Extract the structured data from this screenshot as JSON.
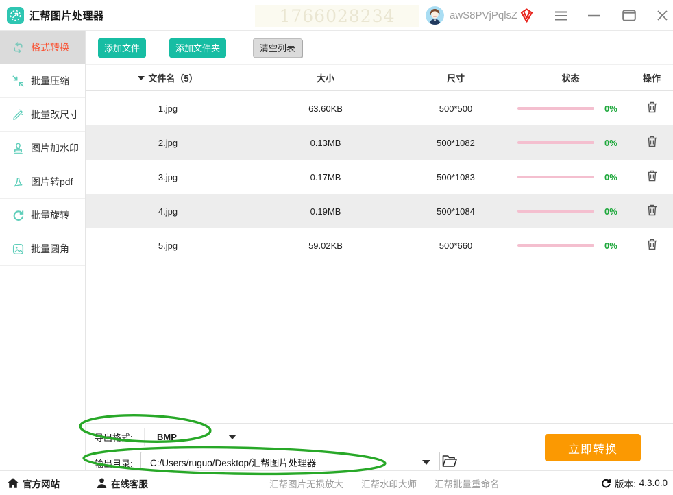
{
  "window": {
    "title": "汇帮图片处理器",
    "watermark_text": "1766028234",
    "user": {
      "name": "awS8PVjPqlsZ"
    }
  },
  "sidebar": {
    "items": [
      {
        "label": "格式转换",
        "active": true
      },
      {
        "label": "批量压缩",
        "active": false
      },
      {
        "label": "批量改尺寸",
        "active": false
      },
      {
        "label": "图片加水印",
        "active": false
      },
      {
        "label": "图片转pdf",
        "active": false
      },
      {
        "label": "批量旋转",
        "active": false
      },
      {
        "label": "批量圆角",
        "active": false
      }
    ]
  },
  "toolbar": {
    "add_file": "添加文件",
    "add_folder": "添加文件夹",
    "clear_list": "清空列表"
  },
  "table": {
    "headers": {
      "name": "文件名（5）",
      "size": "大小",
      "dimensions": "尺寸",
      "status": "状态",
      "action": "操作"
    },
    "rows": [
      {
        "name": "1.jpg",
        "size": "63.60KB",
        "dimensions": "500*500",
        "progress_label": "0%"
      },
      {
        "name": "2.jpg",
        "size": "0.13MB",
        "dimensions": "500*1082",
        "progress_label": "0%"
      },
      {
        "name": "3.jpg",
        "size": "0.17MB",
        "dimensions": "500*1083",
        "progress_label": "0%"
      },
      {
        "name": "4.jpg",
        "size": "0.19MB",
        "dimensions": "500*1084",
        "progress_label": "0%"
      },
      {
        "name": "5.jpg",
        "size": "59.02KB",
        "dimensions": "500*660",
        "progress_label": "0%"
      }
    ]
  },
  "output": {
    "format_label": "导出格式:",
    "format_value": "BMP",
    "dir_label": "输出目录:",
    "dir_value": "C:/Users/ruguo/Desktop/汇帮图片处理器",
    "convert_button": "立即转换"
  },
  "footer": {
    "official_site": "官方网站",
    "online_support": "在线客服",
    "links": [
      "汇帮图片无损放大",
      "汇帮水印大师",
      "汇帮批量重命名"
    ],
    "version_label": "版本:",
    "version": "4.3.0.0"
  },
  "colors": {
    "accent_teal": "#17BDA3",
    "active_red": "#FB4F2F",
    "convert_orange": "#FB9902",
    "progress_pink": "#F4BFCF",
    "percent_green": "#1EA83C",
    "annotation_green": "#28A828",
    "vip_red": "#E8241D"
  }
}
